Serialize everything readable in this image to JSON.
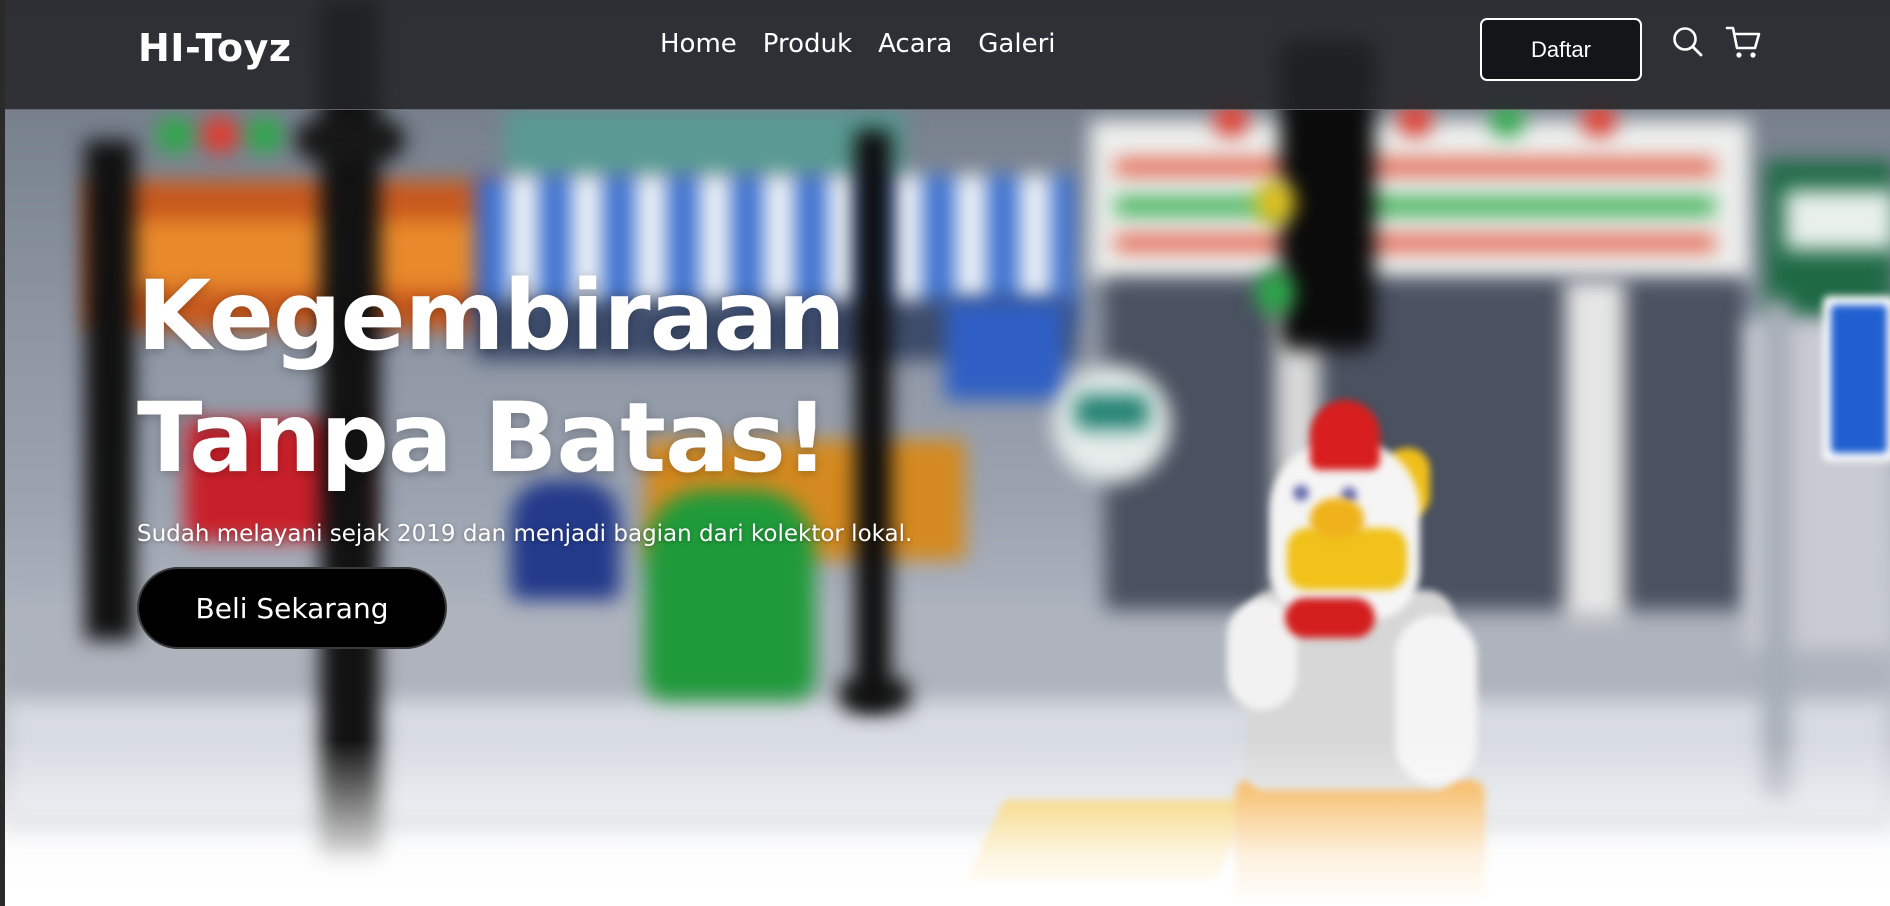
{
  "brand": {
    "name": "HI-Toyz"
  },
  "nav": {
    "links": [
      {
        "label": "Home"
      },
      {
        "label": "Produk"
      },
      {
        "label": "Acara"
      },
      {
        "label": "Galeri"
      }
    ],
    "signup_label": "Daftar",
    "icons": [
      "search-icon",
      "cart-icon"
    ]
  },
  "hero": {
    "title_line1": "Kegembiraan",
    "title_line2": "Tanpa Batas!",
    "subtitle": "Sudah melayani sejak 2019 dan menjadi bagian dari kolektor lokal.",
    "cta_label": "Beli Sekarang",
    "background": "blurred toy city street with chicken-suit minifigure"
  },
  "colors": {
    "navbar_bg": "#232428",
    "text": "#ffffff",
    "cta_bg": "#000000"
  }
}
